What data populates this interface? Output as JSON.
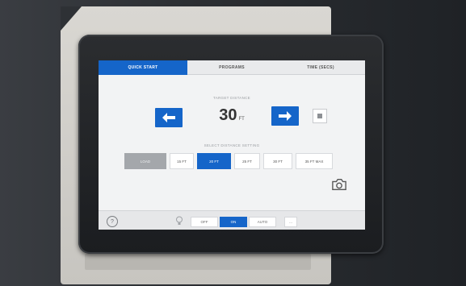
{
  "tabs": [
    {
      "label": "QUICK START",
      "active": true
    },
    {
      "label": "PROGRAMS",
      "active": false
    },
    {
      "label": "TIME (SECS)",
      "active": false
    }
  ],
  "target": {
    "label": "TARGET DISTANCE",
    "value": "30",
    "unit": "FT"
  },
  "distances": {
    "label": "SELECT DISTANCE SETTING",
    "options": [
      {
        "label": "LOAD",
        "style": "gray"
      },
      {
        "label": "15 FT",
        "style": "normal"
      },
      {
        "label": "20 FT",
        "style": "active"
      },
      {
        "label": "25 FT",
        "style": "normal"
      },
      {
        "label": "30 FT",
        "style": "normal"
      },
      {
        "label": "35 FT MAX",
        "style": "normal"
      }
    ]
  },
  "bottom": {
    "help": "?",
    "modes": [
      {
        "label": "OFF",
        "active": false
      },
      {
        "label": "ON",
        "active": true
      },
      {
        "label": "AUTO",
        "active": false
      },
      {
        "label": "...",
        "active": false
      }
    ]
  },
  "colors": {
    "accent": "#1565c9",
    "screen_bg": "#f2f3f4",
    "bezel": "#1f2124"
  },
  "icons": {
    "left": "arrow-left-icon",
    "right": "arrow-right-icon",
    "camera": "camera-icon",
    "bulb": "bulb-icon",
    "help": "help-icon"
  }
}
